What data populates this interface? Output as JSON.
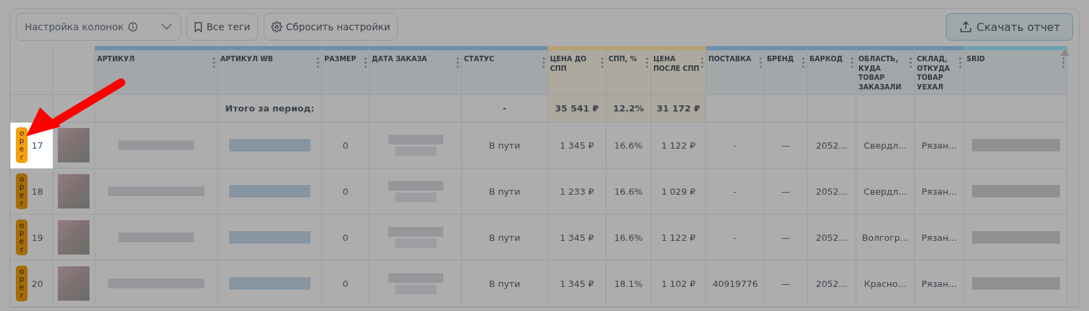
{
  "toolbar": {
    "column_settings": {
      "label": "Настройка колонок"
    },
    "tags_button": {
      "label": "Все теги"
    },
    "reset_button": {
      "label": "Сбросить настройки"
    },
    "download_button": {
      "label": "Скачать отчет"
    }
  },
  "table": {
    "columns": [
      {
        "label": "АРТИКУЛ",
        "color": "#6a8fab"
      },
      {
        "label": "АРТИКУЛ WB",
        "color": "#6a8fab"
      },
      {
        "label": "РАЗМЕР",
        "color": "#6a8fab"
      },
      {
        "label": "ДАТА ЗАКАЗА",
        "color": "#6a8fab"
      },
      {
        "label": "СТАТУС",
        "color": "#6a8fab"
      },
      {
        "label": "ЦЕНА ДО СПП",
        "color": "#b5a072"
      },
      {
        "label": "СПП, %",
        "color": "#b5a072"
      },
      {
        "label": "ЦЕНА ПОСЛЕ СПП",
        "color": "#b5a072"
      },
      {
        "label": "ПОСТАВКА",
        "color": "#6a8fab"
      },
      {
        "label": "БРЕНД",
        "color": "#6a8fab"
      },
      {
        "label": "БАРКОД",
        "color": "#6a8fab"
      },
      {
        "label": "ОБЛАСТЬ, КУДА ТОВАР ЗАКАЗАЛИ",
        "color": "#6a8fab"
      },
      {
        "label": "СКЛАД, ОТКУДА ТОВАР УЕХАЛ",
        "color": "#6a8fab"
      },
      {
        "label": "SRID",
        "color": "#6aa3ad"
      }
    ],
    "totals": {
      "label": "Итого за период:",
      "status": "-",
      "price_before": "35 541 ₽",
      "spp": "12.2%",
      "price_after": "31 172 ₽"
    },
    "rows": [
      {
        "tag": "oper",
        "number": "17",
        "highlighted": true,
        "size": "0",
        "status": "В пути",
        "price_before": "1 345 ₽",
        "spp": "16.6%",
        "price_after": "1 122 ₽",
        "supply": "-",
        "brand": "—",
        "barcode": "2052...",
        "region": "Свердл...",
        "warehouse": "Рязан..."
      },
      {
        "tag": "oper",
        "number": "18",
        "highlighted": false,
        "size": "0",
        "status": "В пути",
        "price_before": "1 233 ₽",
        "spp": "16.6%",
        "price_after": "1 029 ₽",
        "supply": "-",
        "brand": "—",
        "barcode": "2052...",
        "region": "Свердл...",
        "warehouse": "Рязан..."
      },
      {
        "tag": "oper",
        "number": "19",
        "highlighted": false,
        "size": "0",
        "status": "В пути",
        "price_before": "1 345 ₽",
        "spp": "16.6%",
        "price_after": "1 122 ₽",
        "supply": "-",
        "brand": "—",
        "barcode": "2052...",
        "region": "Волгогр...",
        "warehouse": "Рязан..."
      },
      {
        "tag": "oper",
        "number": "20",
        "highlighted": false,
        "size": "0",
        "status": "В пути",
        "price_before": "1 345 ₽",
        "spp": "18.1%",
        "price_after": "1 102 ₽",
        "supply": "40919776",
        "brand": "—",
        "barcode": "2052...",
        "region": "Красно...",
        "warehouse": "Рязан..."
      }
    ]
  }
}
